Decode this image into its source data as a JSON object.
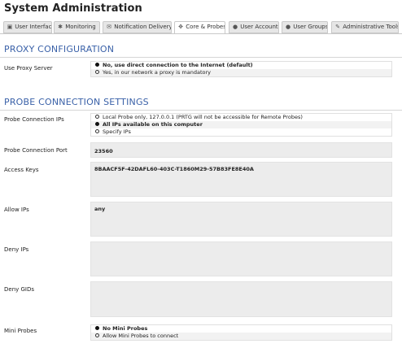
{
  "header": {
    "title": "System Administration"
  },
  "tabs": [
    {
      "label": "User Interface",
      "icon": "monitor-icon",
      "glyph": "▣",
      "active": false
    },
    {
      "label": "Monitoring",
      "icon": "gear-icon",
      "glyph": "✱",
      "active": false
    },
    {
      "label": "Notification Delivery",
      "icon": "envelope-icon",
      "glyph": "✉",
      "active": false
    },
    {
      "label": "Core & Probes",
      "icon": "expand-icon",
      "glyph": "✥",
      "active": true
    },
    {
      "label": "User Accounts",
      "icon": "user-icon",
      "glyph": "●",
      "active": false
    },
    {
      "label": "User Groups",
      "icon": "users-icon",
      "glyph": "●",
      "active": false
    },
    {
      "label": "Administrative Tools",
      "icon": "wrench-icon",
      "glyph": "✎",
      "active": false
    }
  ],
  "proxy": {
    "section_title": "PROXY CONFIGURATION",
    "use_proxy_label": "Use Proxy Server",
    "options": [
      {
        "label": "No, use direct connection to the Internet (default)",
        "selected": true
      },
      {
        "label": "Yes, in our network a proxy is mandatory",
        "selected": false
      }
    ]
  },
  "probe": {
    "section_title": "PROBE CONNECTION SETTINGS",
    "ips_label": "Probe Connection IPs",
    "ip_options": [
      {
        "label": "Local Probe only, 127.0.0.1 (PRTG will not be accessible for Remote Probes)",
        "selected": false
      },
      {
        "label": "All IPs available on this computer",
        "selected": true
      },
      {
        "label": "Specify IPs",
        "selected": false
      }
    ],
    "port_label": "Probe Connection Port",
    "port_value": "23560",
    "access_keys_label": "Access Keys",
    "access_keys_value": "8BAACF5F-42DAFL60-403C-T1860M29-57B83FE8E40A",
    "allow_ips_label": "Allow IPs",
    "allow_ips_value": "any",
    "deny_ips_label": "Deny IPs",
    "deny_ips_value": "",
    "deny_gids_label": "Deny GIDs",
    "deny_gids_value": "",
    "mini_probes_label": "Mini Probes",
    "mini_options": [
      {
        "label": "No Mini Probes",
        "selected": true
      },
      {
        "label": "Allow Mini Probes to connect",
        "selected": false
      }
    ]
  }
}
